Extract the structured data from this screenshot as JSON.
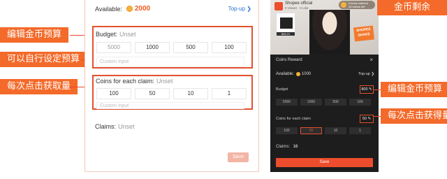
{
  "callouts": {
    "edit_budget": "编辑金币预算",
    "custom_budget": "可以自行设定预算",
    "coins_per_claim": "每次点击获取量",
    "coin_balance": "金币剩余",
    "phone_edit_budget": "编辑金币预算",
    "phone_coins_claim": "每次点击获得量"
  },
  "left_panel": {
    "available_label": "Available:",
    "available_amount": "2000",
    "topup_label": "Top-up ❯",
    "budget": {
      "label": "Budget:",
      "status": "Unset",
      "options": [
        "5000",
        "1000",
        "500",
        "100"
      ],
      "custom_placeholder": "Custom input"
    },
    "coins_claim": {
      "label": "Coins for each claim:",
      "status": "Unset",
      "options": [
        "100",
        "50",
        "10",
        "1"
      ],
      "custom_placeholder": "Custom input"
    },
    "claims_label": "Claims:",
    "claims_status": "Unset",
    "save_label": "Save"
  },
  "phone": {
    "shop_name": "Shopee official",
    "shop_sub": "0 Viewer · 0 Like",
    "coins_pill_line1": "0 times claimed",
    "coins_pill_line2": "16 claims left",
    "product_price": "$98.21",
    "shake_line1": "SHOPEE",
    "shake_line2": "SHAKE",
    "sheet_title": "Coins Reward",
    "close_glyph": "×",
    "available_label": "Available:",
    "available_amount": "1000",
    "topup_label": "Top-up ❯",
    "budget_label": "Budget",
    "budget_value": "800 ✎",
    "budget_options": [
      "5000",
      "1000",
      "500",
      "100"
    ],
    "claim_label": "Coins for each claim",
    "claim_value": "50 ✎",
    "claim_options": [
      "100",
      "50",
      "10",
      "1"
    ],
    "claim_selected_index": 1,
    "claims_label": "Claims:",
    "claims_value": "16",
    "save_label": "Save"
  },
  "colors": {
    "accent": "#f46a2a",
    "highlight_border": "#e3502f",
    "primary_button": "#ee4d2d"
  }
}
